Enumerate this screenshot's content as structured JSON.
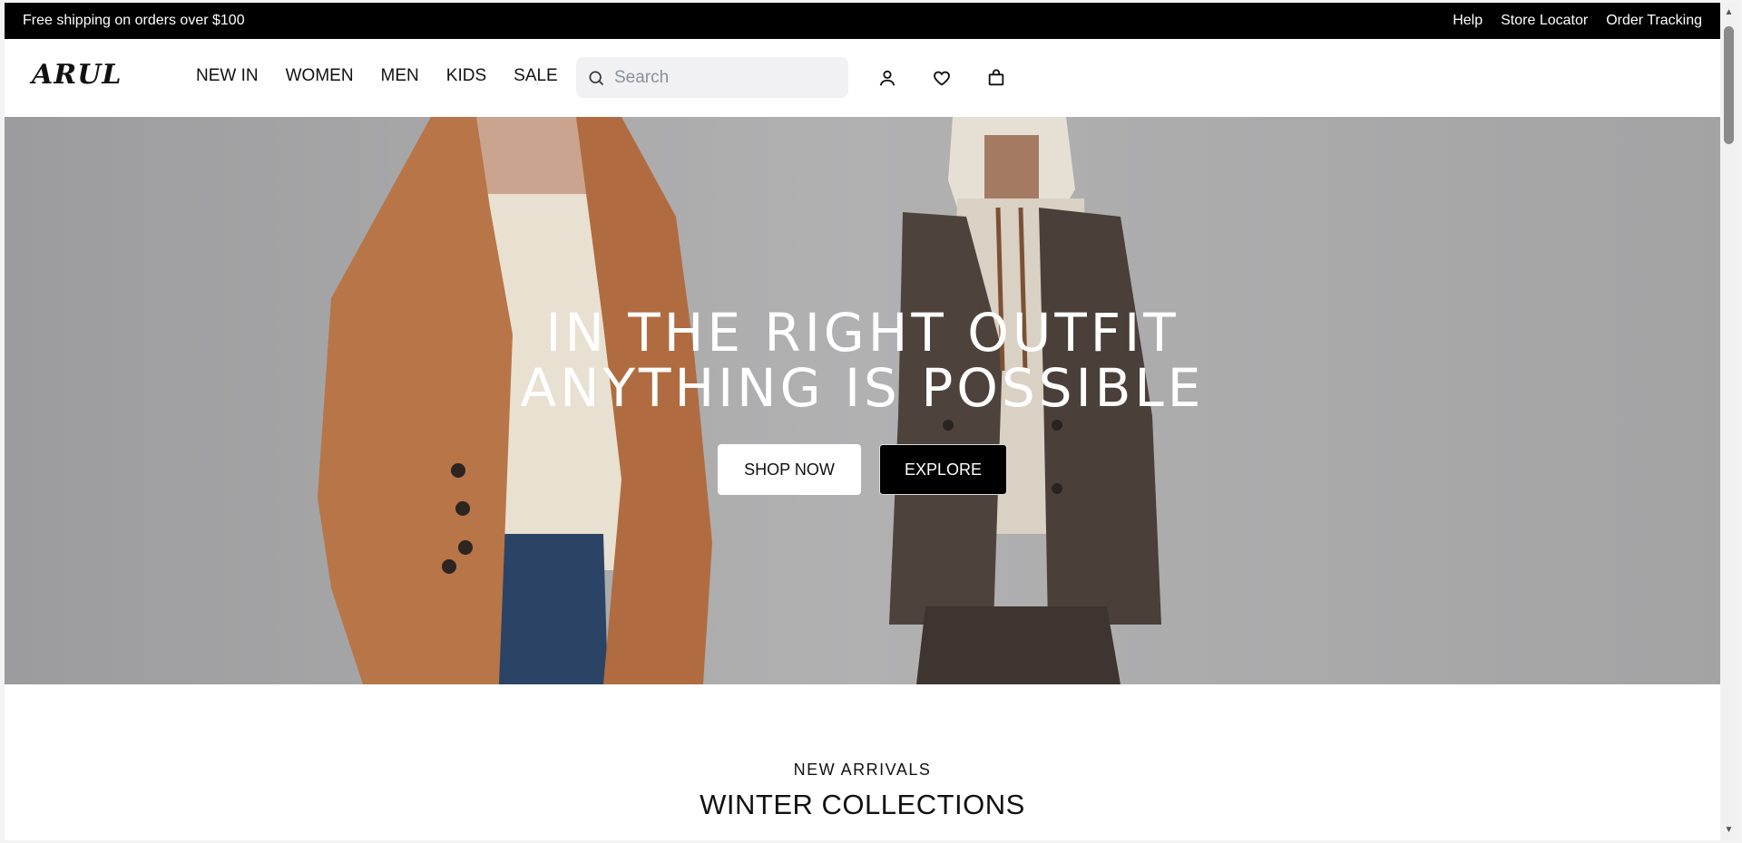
{
  "announcement": {
    "text": "Free shipping on orders over $100",
    "links": [
      "Help",
      "Store Locator",
      "Order Tracking"
    ]
  },
  "header": {
    "logo": "ARUL",
    "nav": [
      "NEW IN",
      "WOMEN",
      "MEN",
      "KIDS",
      "SALE"
    ],
    "search_placeholder": "Search",
    "icons": [
      "account-icon",
      "wishlist-heart-icon",
      "shopping-bag-icon"
    ]
  },
  "hero": {
    "line1": "IN THE RIGHT OUTFIT",
    "line2": "ANYTHING IS POSSIBLE",
    "primary_button": "SHOP NOW",
    "secondary_button": "EXPLORE"
  },
  "section": {
    "eyebrow": "NEW ARRIVALS",
    "title": "WINTER COLLECTIONS"
  },
  "colors": {
    "topbar": "#000000",
    "hero_bg": "#a9a9aa",
    "coat_left": "#b87548",
    "coat_right": "#4e423c"
  }
}
